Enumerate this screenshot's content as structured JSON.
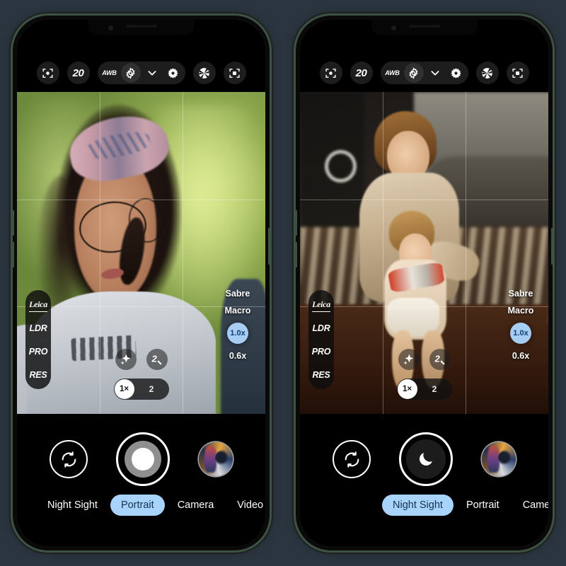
{
  "background_color": "#2b3540",
  "accent_color": "#a8d4fb",
  "phones": [
    {
      "id": "left",
      "frame_color": "#3e5144",
      "toolbar": {
        "focus_frame_icon": "focus-frame-icon",
        "megapixels": "20",
        "white_balance": "AWB",
        "settings_icon": "gear-icon",
        "expand_icon": "chevron-down-icon",
        "brightness_icon": "sun-gear-icon",
        "aperture_icon": "aperture-icon",
        "scan_icon": "scan-focus-icon"
      },
      "left_rail": {
        "brand": "Leica",
        "items": [
          "LDR",
          "PRO",
          "RES"
        ]
      },
      "right_rail": {
        "items": [
          "Sabre",
          "Macro"
        ],
        "zoom_active": "1.0x",
        "zoom_wide": "0.6x"
      },
      "fx": {
        "sparkle_icon": "sparkle-icon",
        "magic_label": "2",
        "magic_icon": "magic-wand-icon"
      },
      "zoom_toggle": {
        "active": "1×",
        "other": "2"
      },
      "shutter": {
        "flip_icon": "flip-camera-icon",
        "shutter_icon": "shutter-circle-icon",
        "gallery_icon": "gallery-thumbnail"
      },
      "modes": [
        {
          "label": "Night Sight",
          "active": false
        },
        {
          "label": "Portrait",
          "active": true
        },
        {
          "label": "Camera",
          "active": false
        },
        {
          "label": "Video",
          "active": false
        }
      ],
      "scene": "portrait-girl-outdoors"
    },
    {
      "id": "right",
      "frame_color": "#3e5144",
      "toolbar": {
        "focus_frame_icon": "focus-frame-icon",
        "megapixels": "20",
        "white_balance": "AWB",
        "settings_icon": "gear-icon",
        "expand_icon": "chevron-down-icon",
        "brightness_icon": "sun-gear-icon",
        "aperture_icon": "aperture-icon",
        "scan_icon": "scan-focus-icon"
      },
      "left_rail": {
        "brand": "Leica",
        "items": [
          "LDR",
          "PRO",
          "RES"
        ]
      },
      "right_rail": {
        "items": [
          "Sabre",
          "Macro"
        ],
        "zoom_active": "1.0x",
        "zoom_wide": "0.6x"
      },
      "fx": {
        "sparkle_icon": "sparkle-icon",
        "magic_label": "2",
        "magic_icon": "magic-wand-icon"
      },
      "zoom_toggle": {
        "active": "1×",
        "other": "2"
      },
      "shutter": {
        "flip_icon": "flip-camera-icon",
        "shutter_icon": "moon-icon",
        "gallery_icon": "gallery-thumbnail"
      },
      "modes": [
        {
          "label": "Night Sight",
          "active": true
        },
        {
          "label": "Portrait",
          "active": false
        },
        {
          "label": "Camera",
          "active": false
        }
      ],
      "scene": "two-children-indoors"
    }
  ]
}
